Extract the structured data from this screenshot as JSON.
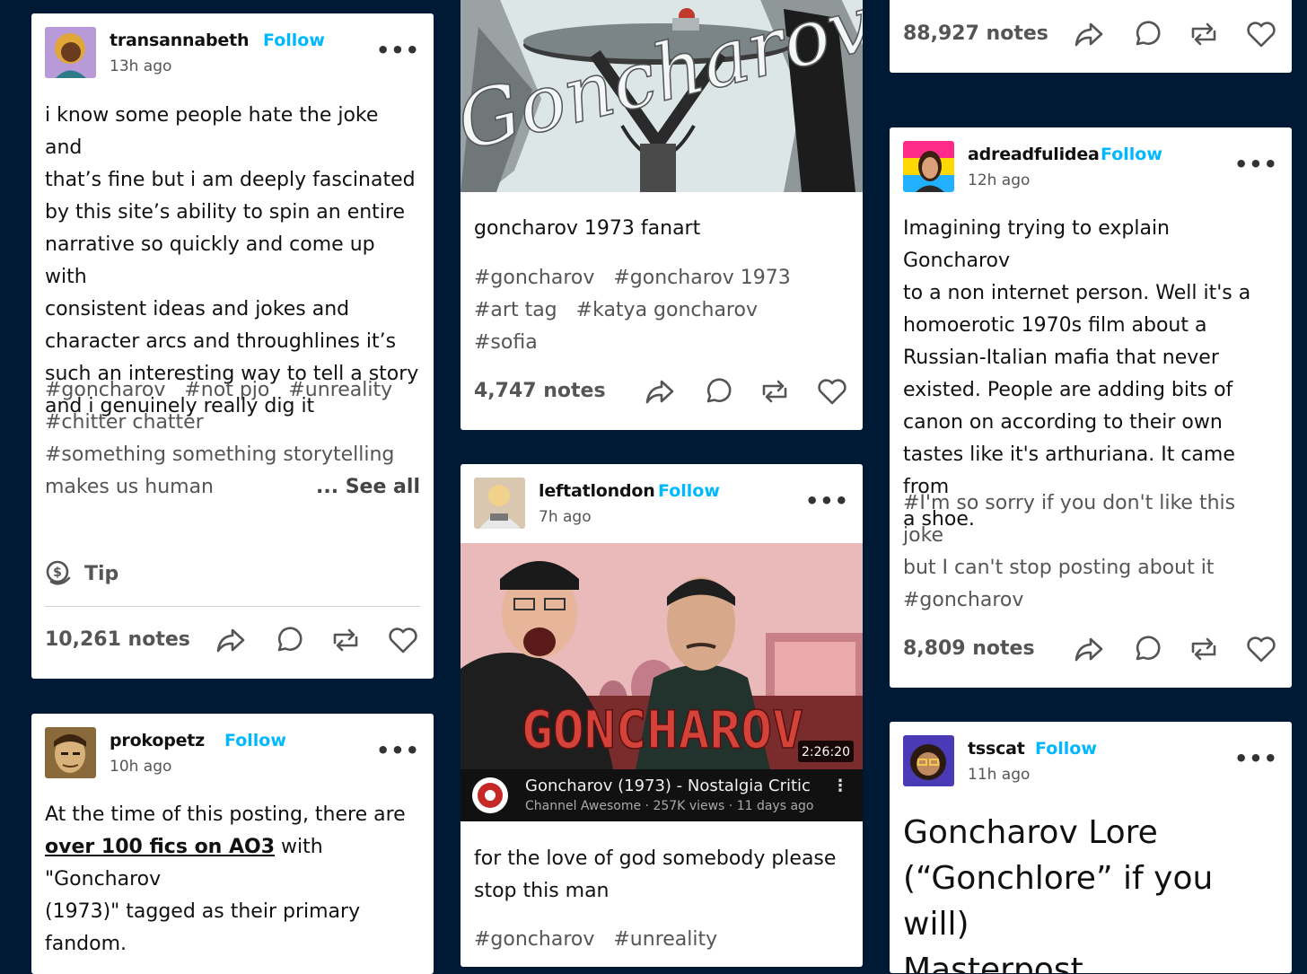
{
  "follow_label": "Follow",
  "more_label": "•••",
  "col1": {
    "post1": {
      "username": "transannabeth",
      "time": "13h ago",
      "body_lines": [
        "i know some people hate the joke and",
        "that’s fine but i am deeply fascinated",
        "by this site’s ability to spin an entire",
        "narrative so quickly and come up with",
        "consistent ideas and jokes and",
        "character arcs and throughlines it’s",
        "such an interesting way to tell a story",
        "and i genuinely really dig it"
      ],
      "tags_row1": [
        "#goncharov",
        "#not pjo",
        "#unreality"
      ],
      "tags_row2": [
        "#chitter chatter"
      ],
      "tags_row3": [
        "#something something storytelling"
      ],
      "tags_row4": [
        "makes us human"
      ],
      "see_all": "... See all",
      "tip": "Tip",
      "notes": "10,261 notes"
    },
    "post2": {
      "username": "prokopetz",
      "time": "10h ago",
      "body_line1": "At the time of this posting, there are",
      "link_text": "over 100 fics on AO3",
      "body_line2_rest": " with \"Goncharov",
      "body_line3": "(1973)\" tagged as their primary",
      "body_line4": "fandom."
    }
  },
  "col2": {
    "post1": {
      "image_text": "Goncharov",
      "caption": "goncharov 1973 fanart",
      "tags_row1": [
        "#goncharov",
        "#goncharov 1973"
      ],
      "tags_row2": [
        "#art tag",
        "#katya goncharov",
        "#sofia"
      ],
      "notes": "4,747 notes"
    },
    "post2": {
      "username": "leftatlondon",
      "time": "7h ago",
      "video_title_overlay": "GONCHAROV",
      "duration": "2:26:20",
      "video_title": "Goncharov (1973) - Nostalgia Critic",
      "video_meta": "Channel Awesome · 257K views · 11 days ago",
      "body_lines": [
        "for the love of god somebody please",
        "stop this man"
      ],
      "tags_row1": [
        "#goncharov",
        "#unreality"
      ]
    }
  },
  "col3": {
    "post0": {
      "notes": "88,927 notes"
    },
    "post1": {
      "username": "adreadfulidea",
      "time": "12h ago",
      "body_lines": [
        "Imagining trying to explain Goncharov",
        "to a non internet person. Well it's a",
        "homoerotic 1970s film about a",
        "Russian-Italian mafia that never",
        "existed. People are adding bits of",
        "canon on according to their own",
        "tastes like it's arthuriana. It came from",
        "a shoe."
      ],
      "tag_lines": [
        "#I'm so sorry if you don't like this joke",
        "but I can't stop posting about it",
        "#goncharov"
      ],
      "notes": "8,809 notes"
    },
    "post2": {
      "username": "tsscat",
      "time": "11h ago",
      "heading_lines": [
        "Goncharov Lore",
        "(“Gonchlore” if you will)",
        "Masterpost"
      ]
    }
  }
}
